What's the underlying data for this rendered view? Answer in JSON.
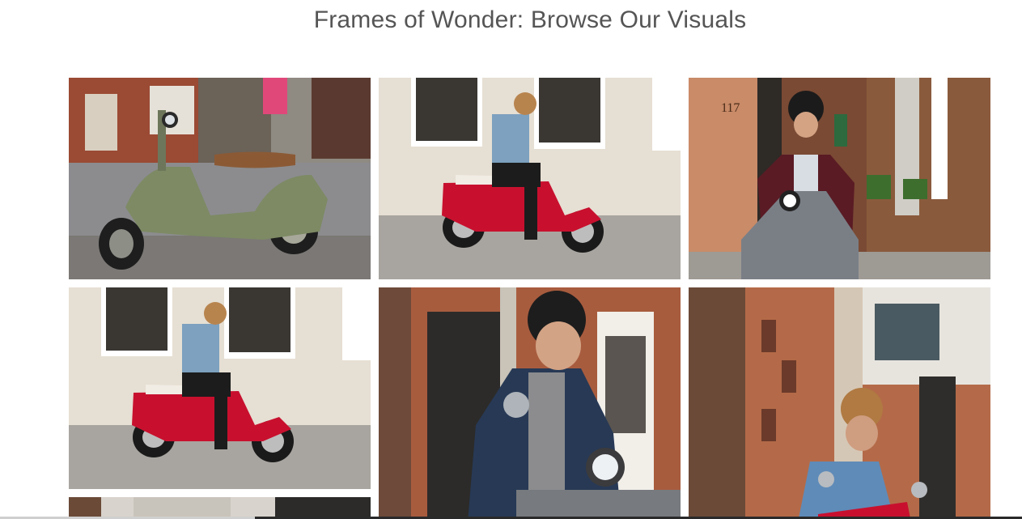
{
  "page": {
    "title": "Frames of Wonder: Browse Our Visuals"
  },
  "gallery": {
    "images": [
      {
        "alt": "Green scooter parked on plaza"
      },
      {
        "alt": "Rider on red scooter in front of window"
      },
      {
        "alt": "Rider in burgundy jacket on grey scooter"
      },
      {
        "alt": "Rider on red scooter in front of window"
      },
      {
        "alt": "Rider in black helmet on scooter"
      },
      {
        "alt": "Rider in brown helmet on red scooter"
      },
      {
        "alt": "Scooter photo"
      }
    ]
  },
  "colors": {
    "title": "#555555",
    "background": "#ffffff",
    "scooter_red": "#c8102e",
    "scooter_green": "#7d8a64",
    "brick": "#a0583a"
  }
}
